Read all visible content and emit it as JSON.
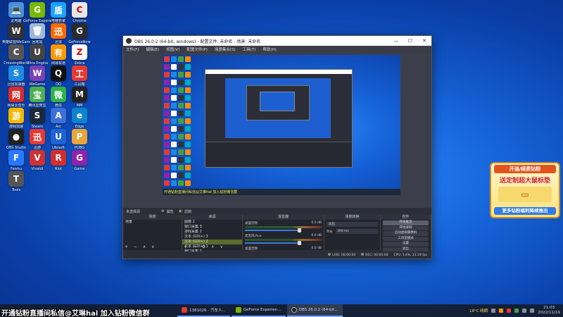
{
  "desktop_icons": [
    {
      "label": "此电脑",
      "color": "#4a90d9",
      "glyph": "💻"
    },
    {
      "label": "GeForce Experience",
      "color": "#76b900",
      "glyph": "G"
    },
    {
      "label": "电脑管家",
      "color": "#1aa3ff",
      "glyph": "盾"
    },
    {
      "label": "Chrome",
      "color": "#e8e8e8",
      "glyph": "C"
    },
    {
      "label": "英雄联盟WeGame",
      "color": "#333333",
      "glyph": "W"
    },
    {
      "label": "回收站",
      "color": "#9fb7d8",
      "glyph": "🗑"
    },
    {
      "label": "迅雷",
      "color": "#ff6a00",
      "glyph": "迅"
    },
    {
      "label": "GeForceNow",
      "color": "#2b2b2b",
      "glyph": "G"
    },
    {
      "label": "CrossingWorld",
      "color": "#555555",
      "glyph": "C"
    },
    {
      "label": "Ultra Engine",
      "color": "#444444",
      "glyph": "U"
    },
    {
      "label": "网易有道",
      "color": "#ff9800",
      "glyph": "有"
    },
    {
      "label": "Zebra",
      "color": "#ffffff",
      "glyph": "Z"
    },
    {
      "label": "迅雷加速器",
      "color": "#1e88e5",
      "glyph": "S"
    },
    {
      "label": "WeGame",
      "color": "#7b3fb5",
      "glyph": "W"
    },
    {
      "label": "QQ",
      "color": "#111111",
      "glyph": "Q"
    },
    {
      "label": "工具箱",
      "color": "#e53935",
      "glyph": "工"
    },
    {
      "label": "网易云音乐",
      "color": "#d32f2f",
      "glyph": "网"
    },
    {
      "label": "腾讯应用宝",
      "color": "#4caf50",
      "glyph": "宝"
    },
    {
      "label": "微信",
      "color": "#2eb24b",
      "glyph": "微"
    },
    {
      "label": "MM",
      "color": "#222222",
      "glyph": "M"
    },
    {
      "label": "游戏加速",
      "color": "#f5b700",
      "glyph": "游"
    },
    {
      "label": "Steam",
      "color": "#1b2838",
      "glyph": "S"
    },
    {
      "label": "Arc",
      "color": "#3d6fd9",
      "glyph": "A"
    },
    {
      "label": "Edge",
      "color": "#0c84d0",
      "glyph": "e"
    },
    {
      "label": "OBS Studio",
      "color": "#222222",
      "glyph": "●"
    },
    {
      "label": "迅游",
      "color": "#e53935",
      "glyph": "迅"
    },
    {
      "label": "Ubisoft",
      "color": "#1e63d6",
      "glyph": "U"
    },
    {
      "label": "PUBG",
      "color": "#e9a63a",
      "glyph": "P"
    },
    {
      "label": "Feishu",
      "color": "#2979ff",
      "glyph": "F"
    },
    {
      "label": "Vivaldi",
      "color": "#cc3333",
      "glyph": "V"
    },
    {
      "label": "Riot",
      "color": "#d32f2f",
      "glyph": "R"
    },
    {
      "label": "Game",
      "color": "#8e24aa",
      "glyph": "G"
    },
    {
      "label": "Tools",
      "color": "#555555",
      "glyph": "T"
    }
  ],
  "obs": {
    "title": "OBS 26.0.2 (64-bit, windows) - 配置文件: 未命名 - 场景: 未命名",
    "menu": [
      "文件(F)",
      "编辑(E)",
      "视图(V)",
      "配置文件(P)",
      "场景集合(S)",
      "工具(T)",
      "帮助(H)"
    ],
    "preview_banner": "开通钻粉直播间私信@艾琳hal 加入钻粉微信群",
    "scene_bar": {
      "label": "未选择源",
      "properties": "属性",
      "filters": "滤镜"
    },
    "docks": {
      "scenes_title": "场景",
      "scenes": [
        "场景"
      ],
      "sources_title": "来源",
      "sources": [
        "图像 2",
        "窗口采集 3",
        "游戏采集 2",
        "文本 (GDI+) 3",
        "文本 (GDI+) 2",
        "文本 (GDI+) 1",
        "窗口采集 2",
        "窗口采集"
      ],
      "mixer_title": "混音器",
      "mixer": [
        {
          "name": "桌面音频",
          "db": "0.0 dB"
        },
        {
          "name": "麦克风/Aux",
          "db": "0.0 dB"
        },
        {
          "name": "桌面音频",
          "db": "0.0 dB"
        }
      ],
      "transitions_title": "场景转换",
      "transition": "淡出",
      "duration_label": "时长",
      "duration": "300 ms",
      "controls_title": "控件",
      "controls": [
        "开始推流",
        "开始录制",
        "启动虚拟摄像机",
        "工作室模式",
        "设置",
        "退出"
      ]
    },
    "status": {
      "live": "LIVE: 00:00:00",
      "rec": "REC: 00:00:00",
      "cpu": "CPU: 3.4%, 23.19 fps"
    }
  },
  "ad_widget": {
    "top": "开通/续费钻粉",
    "title": "送定制超大鼠标垫",
    "bottom": "更多钻粉福利降续推出"
  },
  "promo_text": "开通钻粉直播间私信@艾琳hal 加入钻粉微信群",
  "taskbar": {
    "tasks": [
      {
        "label": "1381026 - 汽车人...",
        "color": "#e53935"
      },
      {
        "label": "GeForce Experien...",
        "color": "#76b900"
      },
      {
        "label": "OBS 26.0.2 (64-bit...",
        "color": "#222222"
      }
    ],
    "weather": "18°C 晴朗",
    "time": "21:03",
    "date": "2022/11/19"
  }
}
